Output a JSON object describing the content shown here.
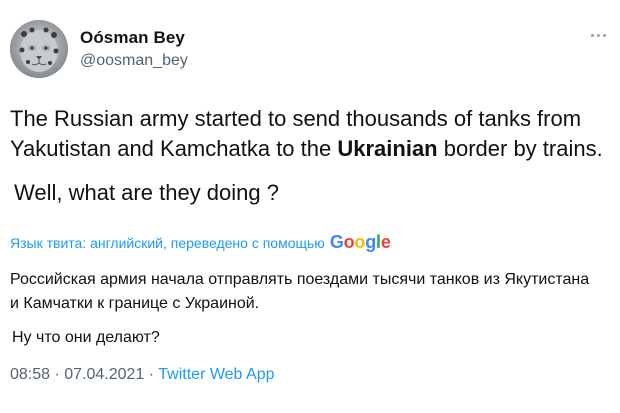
{
  "author": {
    "name": "Oósman Bey",
    "handle": "@oosman_bey"
  },
  "tweet": {
    "en_line1": "The Russian army started to send thousands of tanks from",
    "en_line2_before": "Yakutistan and Kamchatka to the ",
    "en_line2_bold": "Ukrainian",
    "en_line2_after": " border by trains.",
    "en_question": "Well, what are they doing ?"
  },
  "translation": {
    "notice": "Язык твита: английский, переведено с помощью",
    "provider": "Google",
    "provider_letters": [
      "G",
      "o",
      "o",
      "g",
      "l",
      "e"
    ],
    "ru_line1": "Российская армия начала отправлять поездами тысячи танков из Якутистана",
    "ru_line2": "и Камчатки к границе с Украиной.",
    "ru_question": "Ну что они делают?"
  },
  "meta": {
    "time": "08:58",
    "separator1": " · ",
    "date": "07.04.2021",
    "separator2": " · ",
    "app": "Twitter Web App"
  },
  "icons": {
    "avatar": "snow-leopard-avatar",
    "more": "more-options-icon"
  },
  "colors": {
    "link_blue": "#1d9bf0",
    "secondary_gray": "#536471",
    "google_blue": "#4285F4",
    "google_red": "#EA4335",
    "google_yellow": "#FBBC05",
    "google_green": "#34A853"
  }
}
